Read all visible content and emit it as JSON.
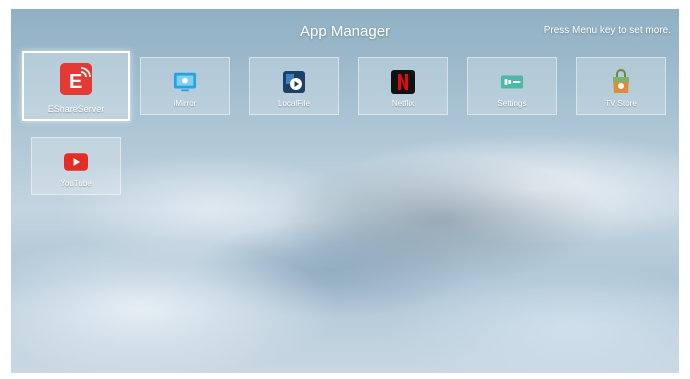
{
  "header": {
    "title": "App Manager",
    "hint": "Press Menu key to set more."
  },
  "apps": [
    {
      "label": "EShareServer",
      "icon": "eshare-icon",
      "focused": true,
      "color": "#e53935"
    },
    {
      "label": "iMirror",
      "icon": "imirror-icon",
      "focused": false,
      "color": "#29a3e0"
    },
    {
      "label": "LocalFile",
      "icon": "localfile-icon",
      "focused": false,
      "color": "#1e3f66"
    },
    {
      "label": "Netflix",
      "icon": "netflix-icon",
      "focused": false,
      "color": "#111111"
    },
    {
      "label": "Settings",
      "icon": "settings-icon",
      "focused": false,
      "color": "#4cb8a8"
    },
    {
      "label": "TV Store",
      "icon": "tvstore-icon",
      "focused": false,
      "color": "#e08a3a"
    },
    {
      "label": "YouTube",
      "icon": "youtube-icon",
      "focused": false,
      "color": "#e52d27"
    }
  ]
}
